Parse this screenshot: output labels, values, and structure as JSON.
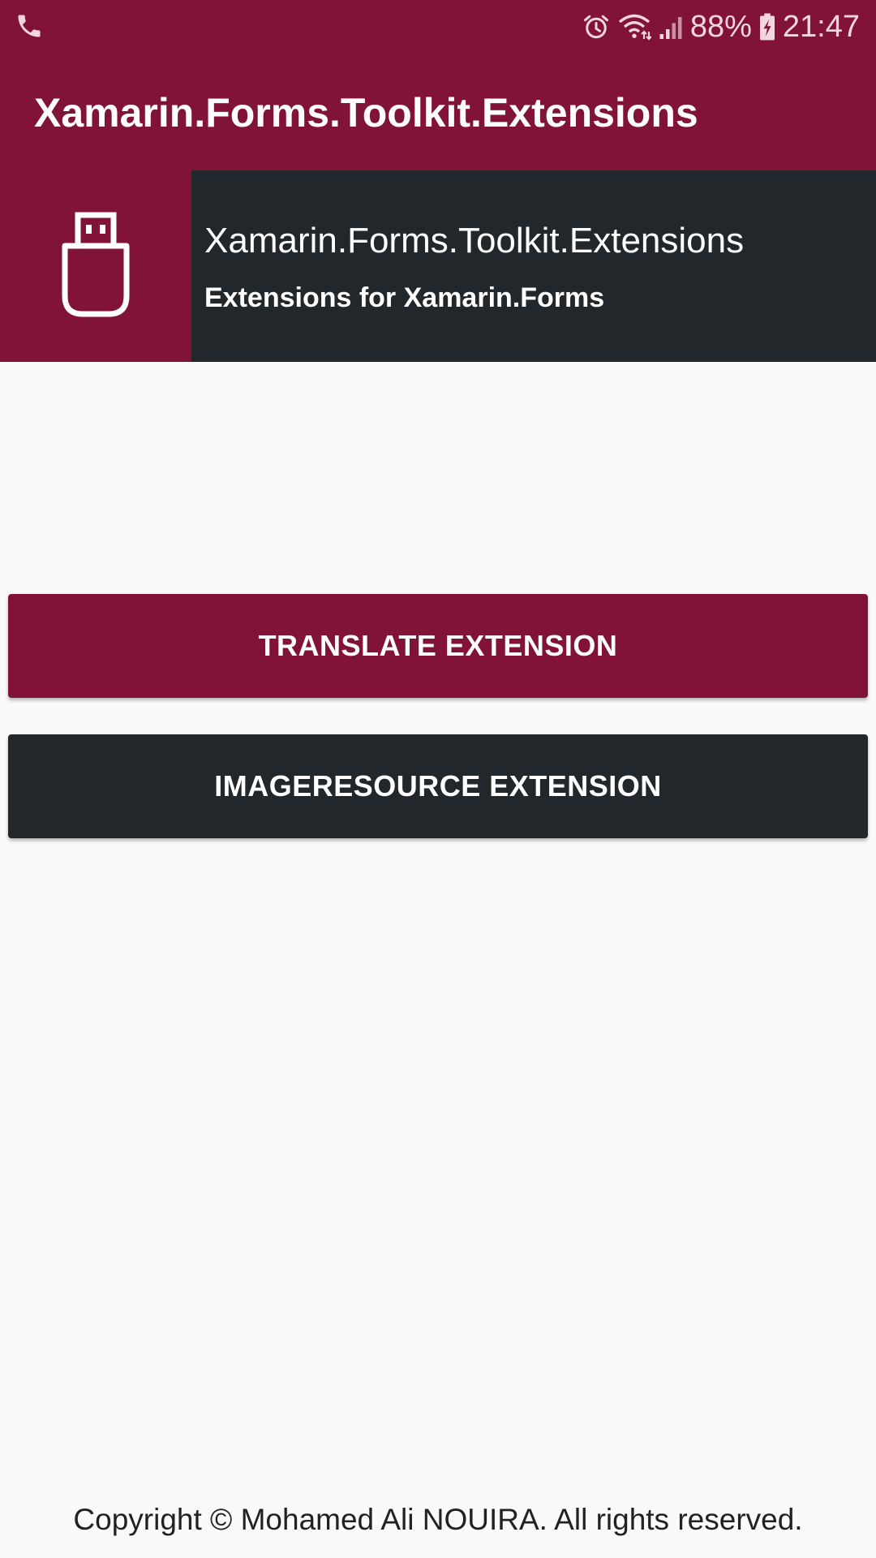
{
  "status_bar": {
    "left_icons": [
      "phone-icon"
    ],
    "right_icons": [
      "alarm-icon",
      "wifi-icon",
      "signal-icon",
      "battery-charging-icon"
    ],
    "battery_text": "88%",
    "time": "21:47"
  },
  "toolbar": {
    "title": "Xamarin.Forms.Toolkit.Extensions"
  },
  "header": {
    "logo_icon": "usb-drive-icon",
    "title": "Xamarin.Forms.Toolkit.Extensions",
    "subtitle": "Extensions for Xamarin.Forms"
  },
  "buttons": {
    "translate_label": "TRANSLATE EXTENSION",
    "imageresource_label": "IMAGERESOURCE EXTENSION"
  },
  "footer": {
    "copyright": "Copyright © Mohamed Ali NOUIRA. All rights reserved."
  },
  "colors": {
    "primary": "#801336",
    "dark": "#22272b",
    "background": "#fafafa",
    "on_primary": "#ffffff"
  }
}
